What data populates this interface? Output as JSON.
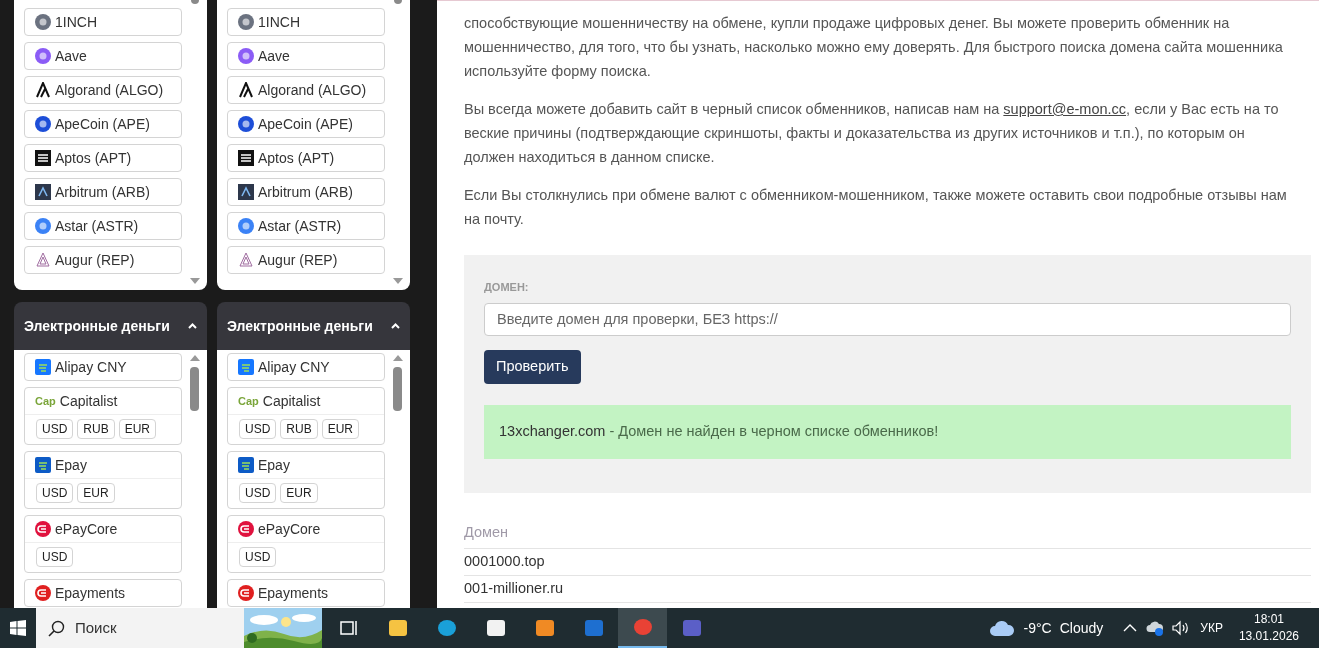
{
  "sidebar": {
    "columns": [
      {
        "crypto_list": {
          "items": [
            "1INCH",
            "Aave",
            "Algorand (ALGO)",
            "ApeCoin (APE)",
            "Aptos (APT)",
            "Arbitrum (ARB)",
            "Astar (ASTR)",
            "Augur (REP)"
          ]
        },
        "emoney_panel": {
          "title": "Электронные деньги",
          "expanded": true,
          "items": [
            {
              "name": "Alipay CNY"
            },
            {
              "name": "Capitalist",
              "logo_text": "Cap",
              "currencies": [
                "USD",
                "RUB",
                "EUR"
              ]
            },
            {
              "name": "Epay",
              "currencies": [
                "USD",
                "EUR"
              ]
            },
            {
              "name": "ePayCore",
              "currencies": [
                "USD"
              ]
            },
            {
              "name": "Epayments"
            }
          ]
        }
      },
      {
        "crypto_list": {
          "items": [
            "1INCH",
            "Aave",
            "Algorand (ALGO)",
            "ApeCoin (APE)",
            "Aptos (APT)",
            "Arbitrum (ARB)",
            "Astar (ASTR)",
            "Augur (REP)"
          ]
        },
        "emoney_panel": {
          "title": "Электронные деньги",
          "expanded": true,
          "items": [
            {
              "name": "Alipay CNY"
            },
            {
              "name": "Capitalist",
              "logo_text": "Cap",
              "currencies": [
                "USD",
                "RUB",
                "EUR"
              ]
            },
            {
              "name": "Epay",
              "currencies": [
                "USD",
                "EUR"
              ]
            },
            {
              "name": "ePayCore",
              "currencies": [
                "USD"
              ]
            },
            {
              "name": "Epayments"
            }
          ]
        }
      }
    ]
  },
  "main": {
    "paragraphs": [
      {
        "text": "способствующие мошенничеству на обмене, купли продаже цифровых денег. Вы можете проверить обменник на мошенничество, для того, что бы узнать, насколько можно ему доверять. Для быстрого поиска домена сайта мошенника используйте форму поиска."
      },
      {
        "text": "Вы всегда можете добавить сайт в черный список обменников, написав нам на ",
        "link": "support@e-mon.cc",
        "after": ", если у Вас есть на то веские причины (подтверждающие скриншоты, факты и доказательства из других источников и т.п.), по которым он должен находиться в данном списке."
      },
      {
        "text": "Если Вы столкнулись при обмене валют с обменником-мошенником, также можете оставить свои подробные отзывы нам на почту."
      }
    ],
    "check_form": {
      "label": "ДОМЕН:",
      "input": {
        "placeholder": "Введите домен для проверки, БЕЗ https://"
      },
      "button": "Проверить",
      "result": {
        "domain": "13xchanger.com",
        "message": " - Домен не найден в черном списке обменников!"
      }
    },
    "table": {
      "columns": [
        "Домен"
      ],
      "rows": [
        [
          "0001000.top"
        ],
        [
          "001-millioner.ru"
        ]
      ]
    }
  },
  "taskbar": {
    "search": {
      "placeholder": "Поиск"
    },
    "apps": [
      {
        "selected": false
      },
      {
        "selected": false
      },
      {
        "selected": false
      },
      {
        "selected": false
      },
      {
        "selected": false
      },
      {
        "selected": false
      },
      {
        "selected": true
      },
      {
        "selected": false
      }
    ],
    "weather": {
      "temperature": "-9°C",
      "condition": "Cloudy"
    },
    "language": "УКР",
    "time": "18:01",
    "date": "13.01.2026"
  }
}
